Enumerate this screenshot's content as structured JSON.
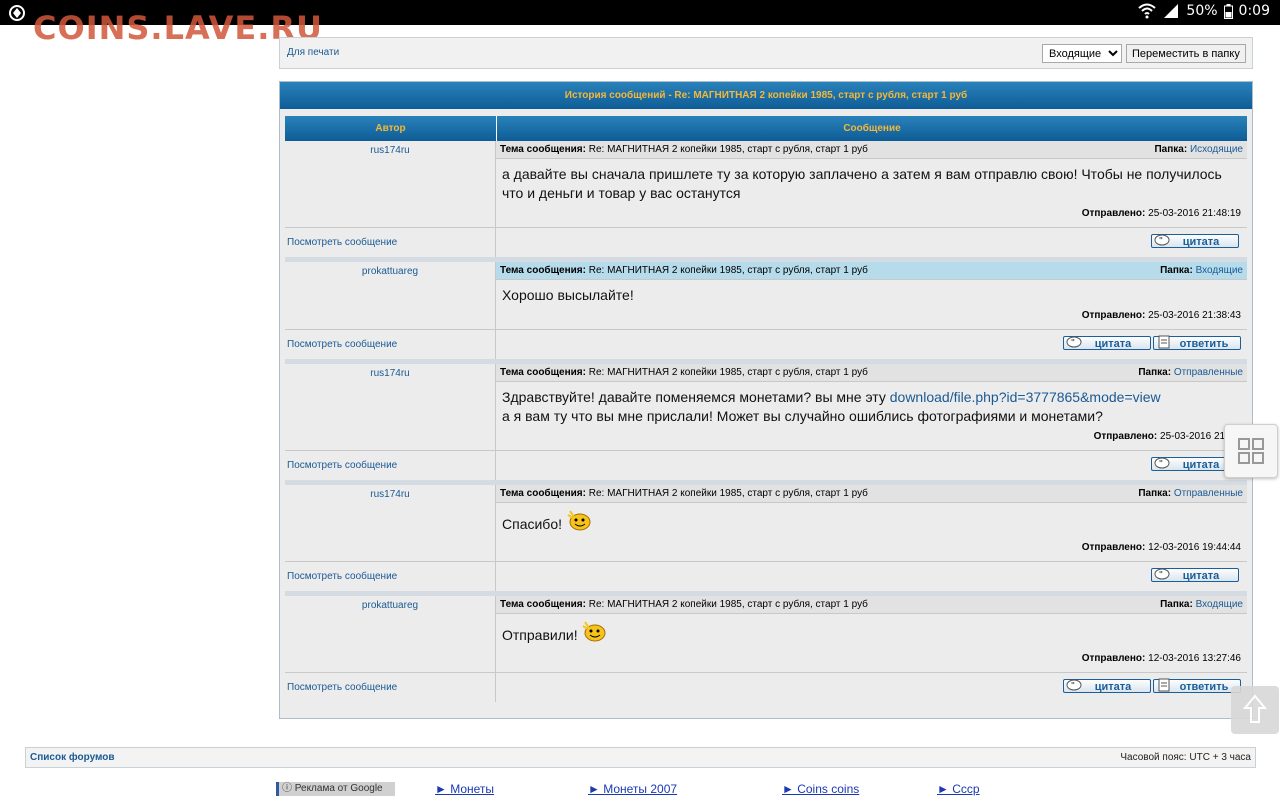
{
  "status_bar": {
    "battery": "50%",
    "time": "0:09"
  },
  "watermark": "COINS.LAVE.RU",
  "toolbar": {
    "print_link": "Для печати",
    "folder_select": "Входящие",
    "move_button": "Переместить в папку"
  },
  "history": {
    "title": "История сообщений - Re: МАГНИТНАЯ 2 копейки 1985, старт с рубля, старт 1 руб",
    "col_author": "Автор",
    "col_message": "Сообщение",
    "subject_label": "Тема сообщения:",
    "folder_label": "Папка:",
    "sent_label": "Отправлено:",
    "view_message": "Посмотреть сообщение",
    "quote_label": "цитата",
    "reply_label": "ответить",
    "messages": [
      {
        "author": "rus174ru",
        "subject": "Re: МАГНИТНАЯ 2 копейки 1985, старт с рубля, старт 1 руб",
        "folder": "Исходящие",
        "text": "а давайте вы сначала пришлете ту за которую заплачено а затем я вам отправлю свою! Чтобы не получилось что и деньги и товар у вас останутся",
        "sent": "25-03-2016 21:48:19"
      },
      {
        "author": "prokattuareg",
        "subject": "Re: МАГНИТНАЯ 2 копейки 1985, старт с рубля, старт 1 руб",
        "folder": "Входящие",
        "text": "Хорошо высылайте!",
        "sent": "25-03-2016 21:38:43"
      },
      {
        "author": "rus174ru",
        "subject": "Re: МАГНИТНАЯ 2 копейки 1985, старт с рубля, старт 1 руб",
        "folder": "Отправленные",
        "text_before": "Здравствуйте! давайте поменяемся монетами? вы мне эту ",
        "link": "download/file.php?id=3777865&mode=view",
        "text_after": "а я вам ту что вы мне прислали! Может вы случайно ошиблись фотографиями и монетами?",
        "sent": "25-03-2016 21:07"
      },
      {
        "author": "rus174ru",
        "subject": "Re: МАГНИТНАЯ 2 копейки 1985, старт с рубля, старт 1 руб",
        "folder": "Отправленные",
        "text": "Спасибо!",
        "sent": "12-03-2016 19:44:44"
      },
      {
        "author": "prokattuareg",
        "subject": "Re: МАГНИТНАЯ 2 копейки 1985, старт с рубля, старт 1 руб",
        "folder": "Входящие",
        "text": "Отправили!",
        "sent": "12-03-2016 13:27:46"
      }
    ]
  },
  "footer": {
    "forum_list": "Список форумов",
    "timezone": "Часовой пояс: UTC + 3 часа",
    "google_ad": "Реклама от Google",
    "links": [
      "► Монеты",
      "► Монеты 2007",
      "► Coins coins",
      "► Ссср"
    ]
  }
}
